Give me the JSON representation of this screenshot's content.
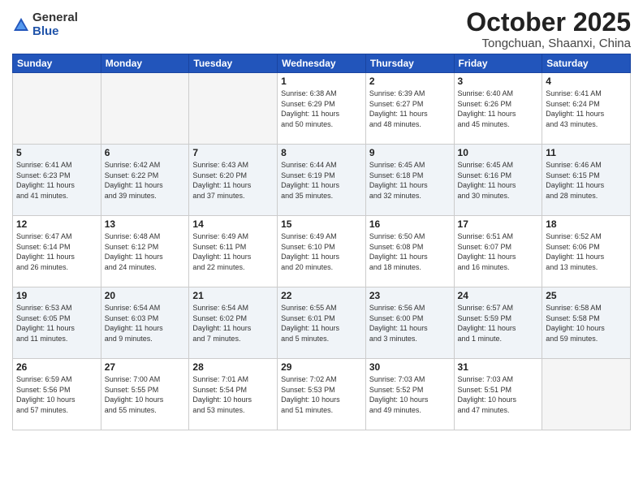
{
  "header": {
    "logo_general": "General",
    "logo_blue": "Blue",
    "month_title": "October 2025",
    "location": "Tongchuan, Shaanxi, China"
  },
  "weekdays": [
    "Sunday",
    "Monday",
    "Tuesday",
    "Wednesday",
    "Thursday",
    "Friday",
    "Saturday"
  ],
  "weeks": [
    [
      {
        "day": "",
        "info": ""
      },
      {
        "day": "",
        "info": ""
      },
      {
        "day": "",
        "info": ""
      },
      {
        "day": "1",
        "info": "Sunrise: 6:38 AM\nSunset: 6:29 PM\nDaylight: 11 hours\nand 50 minutes."
      },
      {
        "day": "2",
        "info": "Sunrise: 6:39 AM\nSunset: 6:27 PM\nDaylight: 11 hours\nand 48 minutes."
      },
      {
        "day": "3",
        "info": "Sunrise: 6:40 AM\nSunset: 6:26 PM\nDaylight: 11 hours\nand 45 minutes."
      },
      {
        "day": "4",
        "info": "Sunrise: 6:41 AM\nSunset: 6:24 PM\nDaylight: 11 hours\nand 43 minutes."
      }
    ],
    [
      {
        "day": "5",
        "info": "Sunrise: 6:41 AM\nSunset: 6:23 PM\nDaylight: 11 hours\nand 41 minutes."
      },
      {
        "day": "6",
        "info": "Sunrise: 6:42 AM\nSunset: 6:22 PM\nDaylight: 11 hours\nand 39 minutes."
      },
      {
        "day": "7",
        "info": "Sunrise: 6:43 AM\nSunset: 6:20 PM\nDaylight: 11 hours\nand 37 minutes."
      },
      {
        "day": "8",
        "info": "Sunrise: 6:44 AM\nSunset: 6:19 PM\nDaylight: 11 hours\nand 35 minutes."
      },
      {
        "day": "9",
        "info": "Sunrise: 6:45 AM\nSunset: 6:18 PM\nDaylight: 11 hours\nand 32 minutes."
      },
      {
        "day": "10",
        "info": "Sunrise: 6:45 AM\nSunset: 6:16 PM\nDaylight: 11 hours\nand 30 minutes."
      },
      {
        "day": "11",
        "info": "Sunrise: 6:46 AM\nSunset: 6:15 PM\nDaylight: 11 hours\nand 28 minutes."
      }
    ],
    [
      {
        "day": "12",
        "info": "Sunrise: 6:47 AM\nSunset: 6:14 PM\nDaylight: 11 hours\nand 26 minutes."
      },
      {
        "day": "13",
        "info": "Sunrise: 6:48 AM\nSunset: 6:12 PM\nDaylight: 11 hours\nand 24 minutes."
      },
      {
        "day": "14",
        "info": "Sunrise: 6:49 AM\nSunset: 6:11 PM\nDaylight: 11 hours\nand 22 minutes."
      },
      {
        "day": "15",
        "info": "Sunrise: 6:49 AM\nSunset: 6:10 PM\nDaylight: 11 hours\nand 20 minutes."
      },
      {
        "day": "16",
        "info": "Sunrise: 6:50 AM\nSunset: 6:08 PM\nDaylight: 11 hours\nand 18 minutes."
      },
      {
        "day": "17",
        "info": "Sunrise: 6:51 AM\nSunset: 6:07 PM\nDaylight: 11 hours\nand 16 minutes."
      },
      {
        "day": "18",
        "info": "Sunrise: 6:52 AM\nSunset: 6:06 PM\nDaylight: 11 hours\nand 13 minutes."
      }
    ],
    [
      {
        "day": "19",
        "info": "Sunrise: 6:53 AM\nSunset: 6:05 PM\nDaylight: 11 hours\nand 11 minutes."
      },
      {
        "day": "20",
        "info": "Sunrise: 6:54 AM\nSunset: 6:03 PM\nDaylight: 11 hours\nand 9 minutes."
      },
      {
        "day": "21",
        "info": "Sunrise: 6:54 AM\nSunset: 6:02 PM\nDaylight: 11 hours\nand 7 minutes."
      },
      {
        "day": "22",
        "info": "Sunrise: 6:55 AM\nSunset: 6:01 PM\nDaylight: 11 hours\nand 5 minutes."
      },
      {
        "day": "23",
        "info": "Sunrise: 6:56 AM\nSunset: 6:00 PM\nDaylight: 11 hours\nand 3 minutes."
      },
      {
        "day": "24",
        "info": "Sunrise: 6:57 AM\nSunset: 5:59 PM\nDaylight: 11 hours\nand 1 minute."
      },
      {
        "day": "25",
        "info": "Sunrise: 6:58 AM\nSunset: 5:58 PM\nDaylight: 10 hours\nand 59 minutes."
      }
    ],
    [
      {
        "day": "26",
        "info": "Sunrise: 6:59 AM\nSunset: 5:56 PM\nDaylight: 10 hours\nand 57 minutes."
      },
      {
        "day": "27",
        "info": "Sunrise: 7:00 AM\nSunset: 5:55 PM\nDaylight: 10 hours\nand 55 minutes."
      },
      {
        "day": "28",
        "info": "Sunrise: 7:01 AM\nSunset: 5:54 PM\nDaylight: 10 hours\nand 53 minutes."
      },
      {
        "day": "29",
        "info": "Sunrise: 7:02 AM\nSunset: 5:53 PM\nDaylight: 10 hours\nand 51 minutes."
      },
      {
        "day": "30",
        "info": "Sunrise: 7:03 AM\nSunset: 5:52 PM\nDaylight: 10 hours\nand 49 minutes."
      },
      {
        "day": "31",
        "info": "Sunrise: 7:03 AM\nSunset: 5:51 PM\nDaylight: 10 hours\nand 47 minutes."
      },
      {
        "day": "",
        "info": ""
      }
    ]
  ]
}
